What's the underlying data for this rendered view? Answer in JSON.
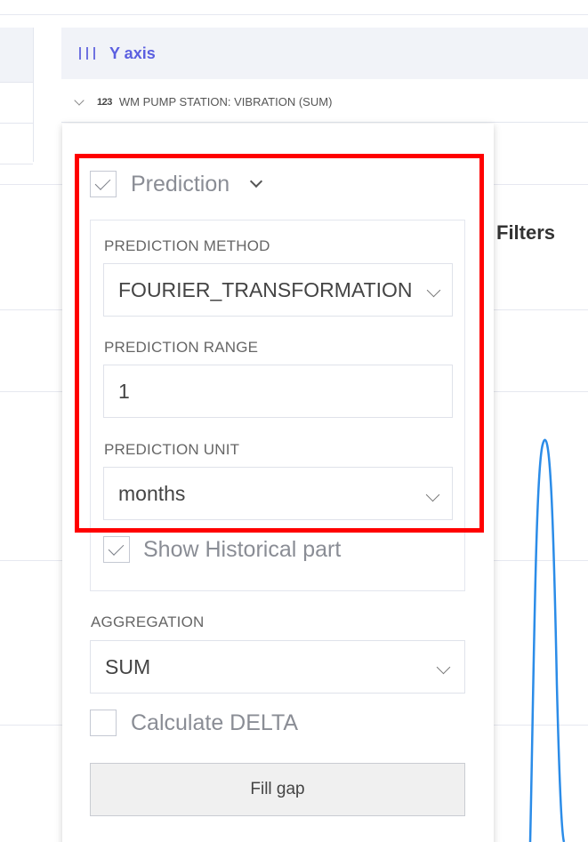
{
  "header": {
    "y_axis_title": "Y axis",
    "y_axis_icon": "bars-icon"
  },
  "field": {
    "type_icon": "123",
    "name": "WM PUMP STATION: VIBRATION (SUM)"
  },
  "filters_label": "Filters",
  "popup": {
    "prediction": {
      "label": "Prediction",
      "checked": true
    },
    "method": {
      "label": "PREDICTION METHOD",
      "value": "FOURIER_TRANSFORMATION"
    },
    "range": {
      "label": "PREDICTION RANGE",
      "value": "1"
    },
    "unit": {
      "label": "PREDICTION UNIT",
      "value": "months"
    },
    "show_historical": {
      "label": "Show Historical part",
      "checked": true
    },
    "aggregation": {
      "label": "AGGREGATION",
      "value": "SUM"
    },
    "calculate_delta": {
      "label": "Calculate DELTA",
      "checked": false
    },
    "fill_gap_label": "Fill gap"
  },
  "colors": {
    "accent": "#5b5fe0",
    "highlight": "#ff0000",
    "series": "#2b8ce8"
  }
}
